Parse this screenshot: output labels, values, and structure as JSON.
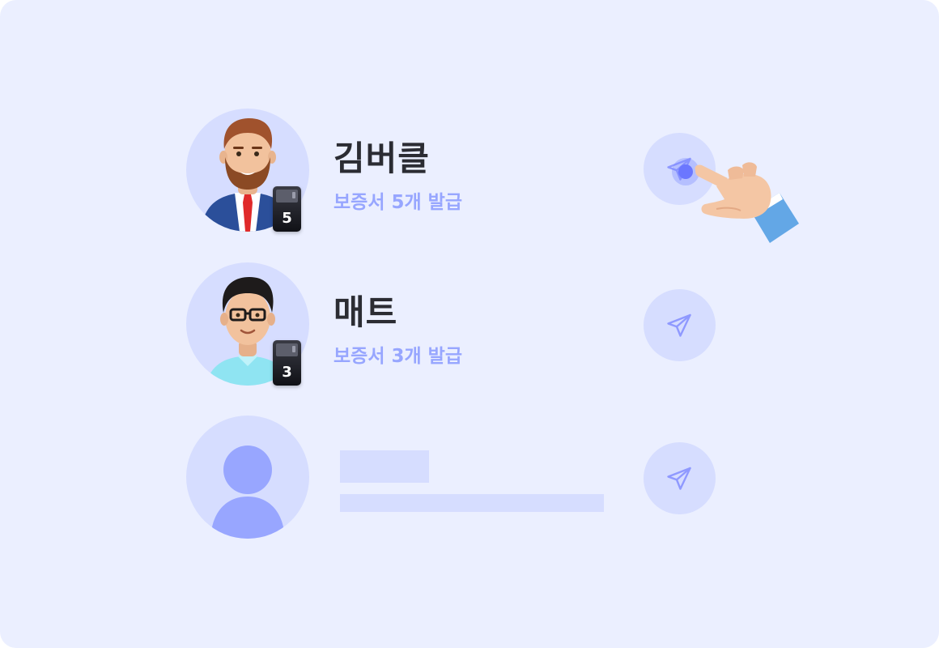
{
  "rows": [
    {
      "name": "김버클",
      "subtitle": "보증서 5개 발급",
      "badge_count": "5",
      "avatar": "bearded-man-suit"
    },
    {
      "name": "매트",
      "subtitle": "보증서 3개 발급",
      "badge_count": "3",
      "avatar": "man-glasses"
    },
    {
      "avatar": "placeholder-user"
    }
  ],
  "icons": {
    "send": "send-icon",
    "pointer": "pointing-hand"
  },
  "colors": {
    "background": "#ebefff",
    "avatar_bg": "#d6ddff",
    "subtitle": "#97a6ff",
    "name": "#2b2c33",
    "accent": "#6b77ff"
  }
}
